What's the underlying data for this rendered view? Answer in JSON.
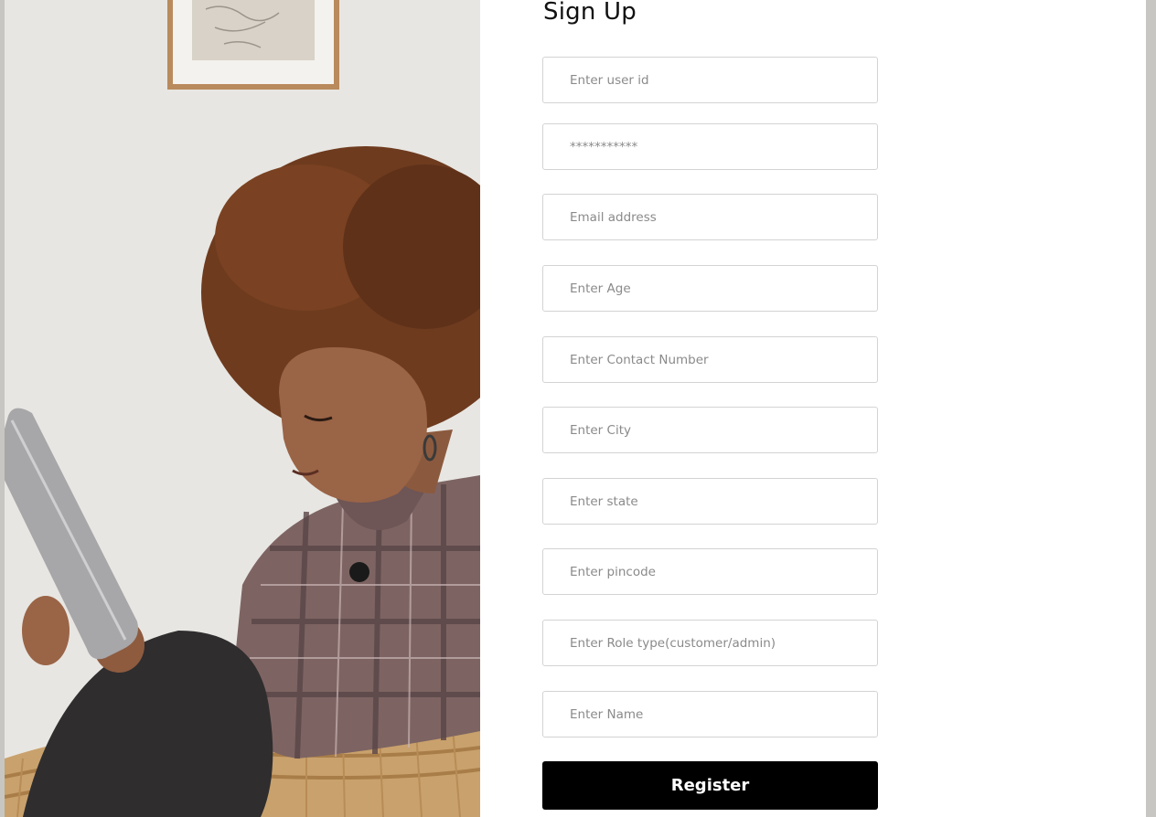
{
  "form": {
    "title": "Sign Up",
    "fields": [
      {
        "placeholder": "Enter user id",
        "value": ""
      },
      {
        "placeholder": "***********",
        "value": ""
      },
      {
        "placeholder": "Email address",
        "value": ""
      },
      {
        "placeholder": "Enter Age",
        "value": ""
      },
      {
        "placeholder": "Enter Contact Number",
        "value": ""
      },
      {
        "placeholder": "Enter City",
        "value": ""
      },
      {
        "placeholder": "Enter state",
        "value": ""
      },
      {
        "placeholder": "Enter pincode",
        "value": ""
      },
      {
        "placeholder": "Enter Role type(customer/admin)",
        "value": ""
      },
      {
        "placeholder": "Enter Name",
        "value": ""
      }
    ],
    "register_label": "Register"
  },
  "colors": {
    "button_bg": "#000000",
    "button_text": "#ffffff",
    "field_border": "#d3d3d3",
    "page_bg": "#ffffff",
    "window_frame": "#c8c6c3"
  },
  "hero_image": {
    "subject": "woman with curly hair in plaid shirt reading a tablet, sitting in wicker chair"
  }
}
